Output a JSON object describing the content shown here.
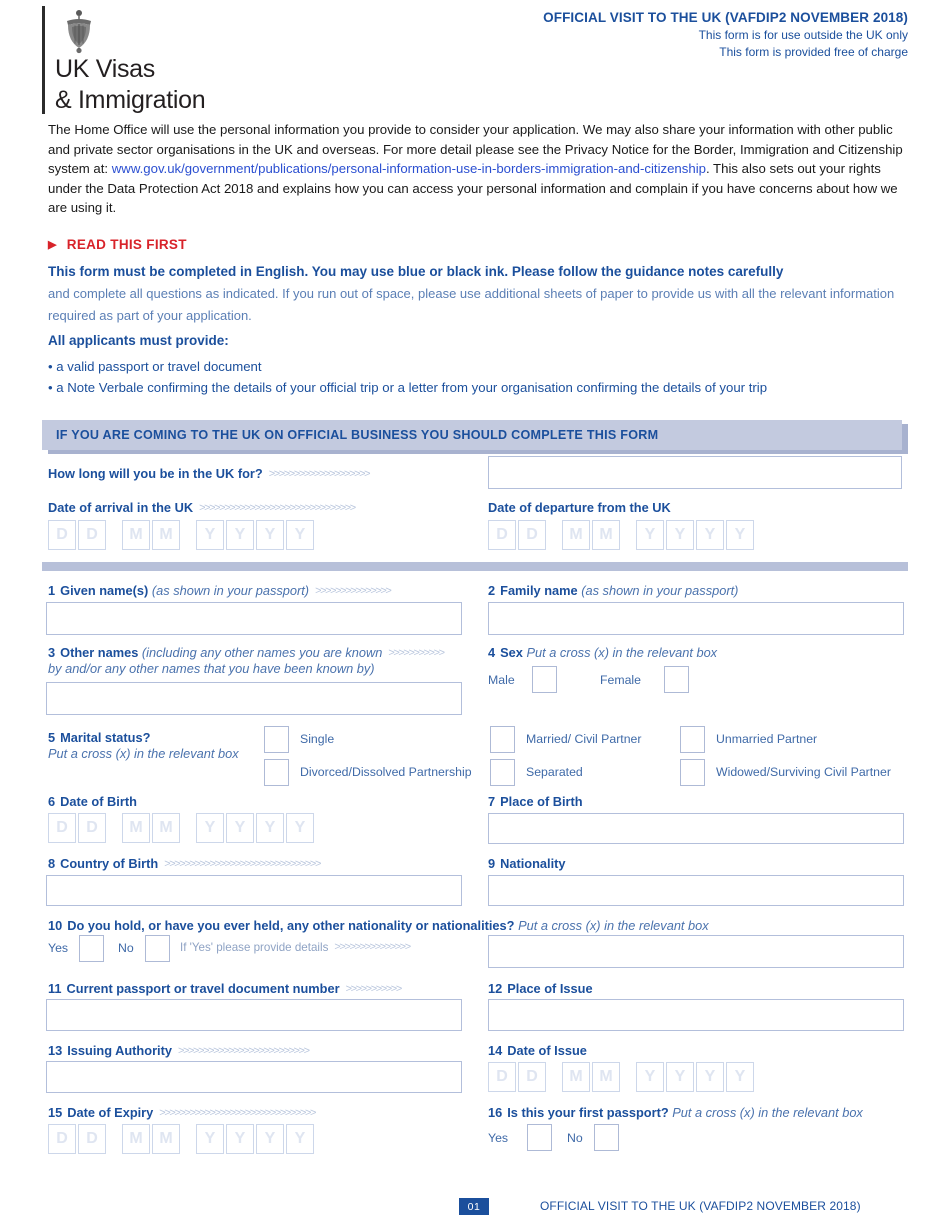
{
  "header": {
    "logo_line1": "UK Visas",
    "logo_line2": "& Immigration",
    "title": "OFFICIAL VISIT TO THE UK (VAFDIP2 NOVEMBER 2018)",
    "sub1": "This form is for use outside the UK only",
    "sub2": "This form is provided free of charge"
  },
  "intro": {
    "part1": "The Home Office will use the personal information you provide to consider your application. We may also share your information with other public and private sector organisations in the UK and overseas. For more detail please see the Privacy Notice for the Border, Immigration and Citizenship system at: ",
    "link": "www.gov.uk/government/publications/personal-information-use-in-borders-immigration-and-citizenship",
    "part2": ". This also sets out your rights under the Data Protection Act 2018 and explains how you can access your personal information and complain if you have concerns about how we are using it."
  },
  "read_first": {
    "heading": "READ THIS FIRST",
    "arrow": "▶",
    "bold_line": "This form must be completed in English. You may use blue or black ink. Please follow the guidance notes carefully",
    "light_lines": "and complete all questions as indicated. If you run out of space, please use additional sheets of paper to provide us with all the relevant information required as part of your application.",
    "must_provide_heading": "All applicants must provide:",
    "bullets": [
      "• a valid passport or travel document",
      "• a Note Verbale confirming the details of your official trip or a letter from your organisation confirming the details of your trip"
    ]
  },
  "banner": {
    "text": "IF YOU ARE COMING TO THE UK ON OFFICIAL BUSINESS YOU SHOULD COMPLETE THIS FORM"
  },
  "dots": {
    "short": ">>>>>>>>>>>",
    "med": ">>>>>>>>>>>>>>>",
    "long": ">>>>>>>>>>>>>>>>>>>>",
    "xlong": ">>>>>>>>>>>>>>>>>>>>>>>>>>",
    "xxlong": ">>>>>>>>>>>>>>>>>>>>>>>>>>>>>>>"
  },
  "date_placeholders": [
    "D",
    "D",
    "M",
    "M",
    "Y",
    "Y",
    "Y",
    "Y"
  ],
  "fields": {
    "how_long": {
      "label": "How long will you be in the UK for?",
      "value": ""
    },
    "date_arrival": {
      "label": "Date of arrival in the UK"
    },
    "date_departure": {
      "label": "Date of departure from the UK"
    },
    "q1": {
      "num": "1",
      "label": "Given name(s)",
      "hint": "(as shown in your passport)",
      "value": ""
    },
    "q2": {
      "num": "2",
      "label": "Family name",
      "hint": "(as shown in your passport)",
      "value": ""
    },
    "q3": {
      "num": "3",
      "label": "Other names",
      "hint_line1": "(including any other names you are known",
      "hint_line2": "by and/or any other names that you have been known by)",
      "value": ""
    },
    "q4": {
      "num": "4",
      "label": "Sex",
      "hint": "Put a cross (x) in the relevant box",
      "options": [
        "Male",
        "Female"
      ]
    },
    "q5": {
      "num": "5",
      "label": "Marital status?",
      "hint": "Put a cross (x) in the relevant box",
      "options": [
        "Single",
        "Married/ Civil Partner",
        "Unmarried Partner",
        "Divorced/Dissolved Partnership",
        "Separated",
        "Widowed/Surviving Civil Partner"
      ]
    },
    "q6": {
      "num": "6",
      "label": "Date of Birth"
    },
    "q7": {
      "num": "7",
      "label": "Place of Birth",
      "value": ""
    },
    "q8": {
      "num": "8",
      "label": "Country of Birth",
      "value": ""
    },
    "q9": {
      "num": "9",
      "label": "Nationality",
      "value": ""
    },
    "q10": {
      "num": "10",
      "label": "Do you hold, or have you ever held, any other nationality or nationalities?",
      "hint": "Put a cross (x) in the relevant box",
      "yes": "Yes",
      "no": "No",
      "detail_prompt": "If 'Yes' please provide details",
      "value": ""
    },
    "q11": {
      "num": "11",
      "label": "Current passport or travel document number",
      "value": ""
    },
    "q12": {
      "num": "12",
      "label": "Place of Issue",
      "value": ""
    },
    "q13": {
      "num": "13",
      "label": "Issuing Authority",
      "value": ""
    },
    "q14": {
      "num": "14",
      "label": "Date of Issue"
    },
    "q15": {
      "num": "15",
      "label": "Date of Expiry"
    },
    "q16": {
      "num": "16",
      "label": "Is this your first passport?",
      "hint": "Put a cross (x) in the relevant box",
      "yes": "Yes",
      "no": "No"
    }
  },
  "footer": {
    "page_number": "01",
    "text": "OFFICIAL VISIT TO THE UK (VAFDIP2 NOVEMBER 2018)"
  },
  "colors": {
    "brand_blue": "#1b4f9c",
    "red": "#d8232a",
    "link": "#2b4fd1",
    "banner": "#c3cadf",
    "divider": "#b7c0d9"
  }
}
